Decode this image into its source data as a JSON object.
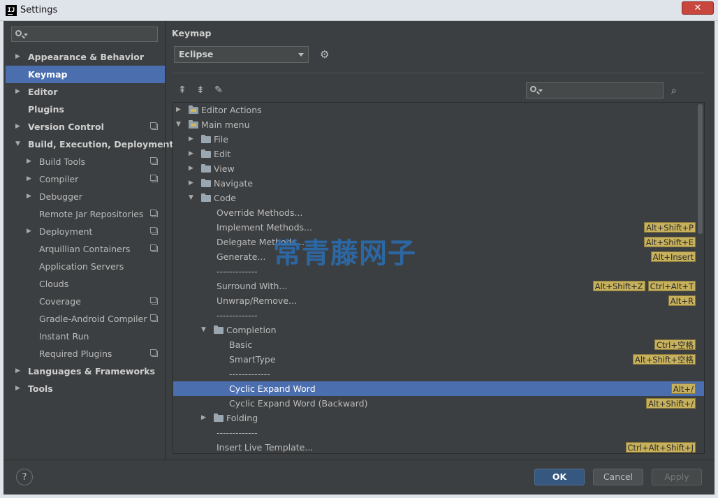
{
  "window": {
    "title": "Settings",
    "app_icon": "IJ",
    "close": "✕"
  },
  "sidebar": {
    "search_placeholder": "",
    "items": [
      {
        "label": "Appearance & Behavior",
        "level": 0,
        "arrow": "▶",
        "project": false
      },
      {
        "label": "Keymap",
        "level": 0,
        "arrow": "",
        "selected": true,
        "project": false
      },
      {
        "label": "Editor",
        "level": 0,
        "arrow": "▶",
        "project": false
      },
      {
        "label": "Plugins",
        "level": 0,
        "arrow": "",
        "project": false
      },
      {
        "label": "Version Control",
        "level": 0,
        "arrow": "▶",
        "project": true
      },
      {
        "label": "Build, Execution, Deployment",
        "level": 0,
        "arrow": "▼",
        "project": false
      },
      {
        "label": "Build Tools",
        "level": 1,
        "arrow": "▶",
        "project": true
      },
      {
        "label": "Compiler",
        "level": 1,
        "arrow": "▶",
        "project": true
      },
      {
        "label": "Debugger",
        "level": 1,
        "arrow": "▶",
        "project": false
      },
      {
        "label": "Remote Jar Repositories",
        "level": 1,
        "arrow": "",
        "project": true
      },
      {
        "label": "Deployment",
        "level": 1,
        "arrow": "▶",
        "project": true
      },
      {
        "label": "Arquillian Containers",
        "level": 1,
        "arrow": "",
        "project": true
      },
      {
        "label": "Application Servers",
        "level": 1,
        "arrow": "",
        "project": false
      },
      {
        "label": "Clouds",
        "level": 1,
        "arrow": "",
        "project": false
      },
      {
        "label": "Coverage",
        "level": 1,
        "arrow": "",
        "project": true
      },
      {
        "label": "Gradle-Android Compiler",
        "level": 1,
        "arrow": "",
        "project": true
      },
      {
        "label": "Instant Run",
        "level": 1,
        "arrow": "",
        "project": false
      },
      {
        "label": "Required Plugins",
        "level": 1,
        "arrow": "",
        "project": true
      },
      {
        "label": "Languages & Frameworks",
        "level": 0,
        "arrow": "▶",
        "project": false
      },
      {
        "label": "Tools",
        "level": 0,
        "arrow": "▶",
        "project": false
      }
    ]
  },
  "panel": {
    "title": "Keymap",
    "keymap_value": "Eclipse",
    "toolbar": {
      "expand_all": "⇞",
      "collapse_all": "⇟",
      "edit": "✎",
      "gear": "⚙",
      "find_shortcut": "⌕"
    },
    "search_placeholder": "",
    "actions": [
      {
        "label": "Editor Actions",
        "level": 0,
        "arrow": "▶",
        "folder": "special",
        "shortcuts": []
      },
      {
        "label": "Main menu",
        "level": 0,
        "arrow": "▼",
        "folder": "special",
        "shortcuts": []
      },
      {
        "label": "File",
        "level": 1,
        "arrow": "▶",
        "folder": "plain",
        "shortcuts": []
      },
      {
        "label": "Edit",
        "level": 1,
        "arrow": "▶",
        "folder": "plain",
        "shortcuts": []
      },
      {
        "label": "View",
        "level": 1,
        "arrow": "▶",
        "folder": "plain",
        "shortcuts": []
      },
      {
        "label": "Navigate",
        "level": 1,
        "arrow": "▶",
        "folder": "plain",
        "shortcuts": []
      },
      {
        "label": "Code",
        "level": 1,
        "arrow": "▼",
        "folder": "plain",
        "shortcuts": []
      },
      {
        "label": "Override Methods...",
        "level": 2,
        "arrow": "",
        "folder": "",
        "shortcuts": []
      },
      {
        "label": "Implement Methods...",
        "level": 2,
        "arrow": "",
        "folder": "",
        "shortcuts": [
          "Alt+Shift+P"
        ]
      },
      {
        "label": "Delegate Methods...",
        "level": 2,
        "arrow": "",
        "folder": "",
        "shortcuts": [
          "Alt+Shift+E"
        ]
      },
      {
        "label": "Generate...",
        "level": 2,
        "arrow": "",
        "folder": "",
        "shortcuts": [
          "Alt+Insert"
        ]
      },
      {
        "label": "-------------",
        "level": 2,
        "arrow": "",
        "folder": "",
        "shortcuts": []
      },
      {
        "label": "Surround With...",
        "level": 2,
        "arrow": "",
        "folder": "",
        "shortcuts": [
          "Alt+Shift+Z",
          "Ctrl+Alt+T"
        ]
      },
      {
        "label": "Unwrap/Remove...",
        "level": 2,
        "arrow": "",
        "folder": "",
        "shortcuts": [
          "Alt+R"
        ]
      },
      {
        "label": "-------------",
        "level": 2,
        "arrow": "",
        "folder": "",
        "shortcuts": []
      },
      {
        "label": "Completion",
        "level": 2,
        "arrow": "▼",
        "folder": "plain",
        "shortcuts": []
      },
      {
        "label": "Basic",
        "level": 3,
        "arrow": "",
        "folder": "",
        "shortcuts": [
          "Ctrl+空格"
        ]
      },
      {
        "label": "SmartType",
        "level": 3,
        "arrow": "",
        "folder": "",
        "shortcuts": [
          "Alt+Shift+空格"
        ]
      },
      {
        "label": "-------------",
        "level": 3,
        "arrow": "",
        "folder": "",
        "shortcuts": []
      },
      {
        "label": "Cyclic Expand Word",
        "level": 3,
        "arrow": "",
        "folder": "",
        "selected": true,
        "shortcuts": [
          "Alt+/"
        ]
      },
      {
        "label": "Cyclic Expand Word (Backward)",
        "level": 3,
        "arrow": "",
        "folder": "",
        "shortcuts": [
          "Alt+Shift+/"
        ]
      },
      {
        "label": "Folding",
        "level": 2,
        "arrow": "▶",
        "folder": "plain",
        "shortcuts": []
      },
      {
        "label": "-------------",
        "level": 2,
        "arrow": "",
        "folder": "",
        "shortcuts": []
      },
      {
        "label": "Insert Live Template...",
        "level": 2,
        "arrow": "",
        "folder": "",
        "shortcuts": [
          "Ctrl+Alt+Shift+J"
        ]
      }
    ]
  },
  "watermark": "常青藤网子",
  "footer": {
    "help": "?",
    "ok": "OK",
    "cancel": "Cancel",
    "apply": "Apply"
  },
  "colors": {
    "background": "#3c3f41",
    "selection": "#4b6eaf",
    "shortcut_bg": "#c7b15c",
    "watermark": "#2a6fb5"
  }
}
